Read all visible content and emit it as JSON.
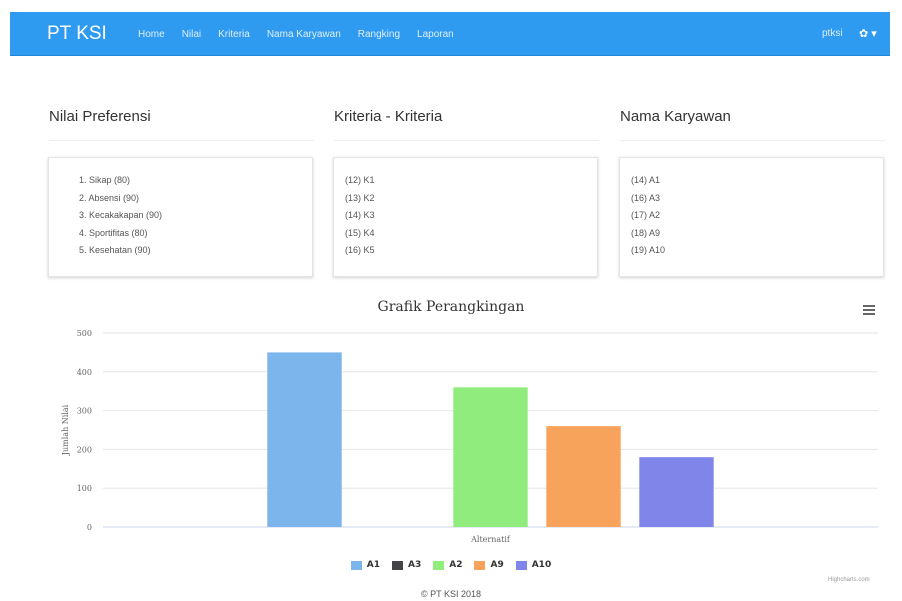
{
  "navbar": {
    "brand": "PT KSI",
    "links": [
      "Home",
      "Nilai",
      "Kriteria",
      "Nama Karyawan",
      "Rangking",
      "Laporan"
    ],
    "user": "ptksi",
    "settings_glyph": "✿ ▾"
  },
  "sections": [
    {
      "title": "Nilai Preferensi",
      "items": [
        "1. Sikap (80)",
        "2. Absensi (90)",
        "3. Kecakakapan (90)",
        "4. Sportifitas (80)",
        "5. Kesehatan (90)"
      ]
    },
    {
      "title": "Kriteria - Kriteria",
      "items": [
        "(12) K1",
        "(13) K2",
        "(14) K3",
        "(15) K4",
        "(16) K5"
      ]
    },
    {
      "title": "Nama Karyawan",
      "items": [
        "(14) A1",
        "(16) A3",
        "(17) A2",
        "(18) A9",
        "(19) A10"
      ]
    }
  ],
  "chart_data": {
    "type": "bar",
    "title": "Grafik Perangkingan",
    "xlabel": "Alternatif",
    "ylabel": "Jumlah Nilai",
    "ylim": [
      0,
      500
    ],
    "yticks": [
      0,
      100,
      200,
      300,
      400,
      500
    ],
    "grid": true,
    "legend_position": "bottom",
    "series": [
      {
        "name": "A1",
        "value": 450,
        "color": "#7cb5ec"
      },
      {
        "name": "A3",
        "value": 0,
        "color": "#434348"
      },
      {
        "name": "A2",
        "value": 360,
        "color": "#90ed7d"
      },
      {
        "name": "A9",
        "value": 260,
        "color": "#f7a35c"
      },
      {
        "name": "A10",
        "value": 180,
        "color": "#8085e9"
      }
    ]
  },
  "credits": "Highcharts.com",
  "footer": "© PT KSI 2018"
}
